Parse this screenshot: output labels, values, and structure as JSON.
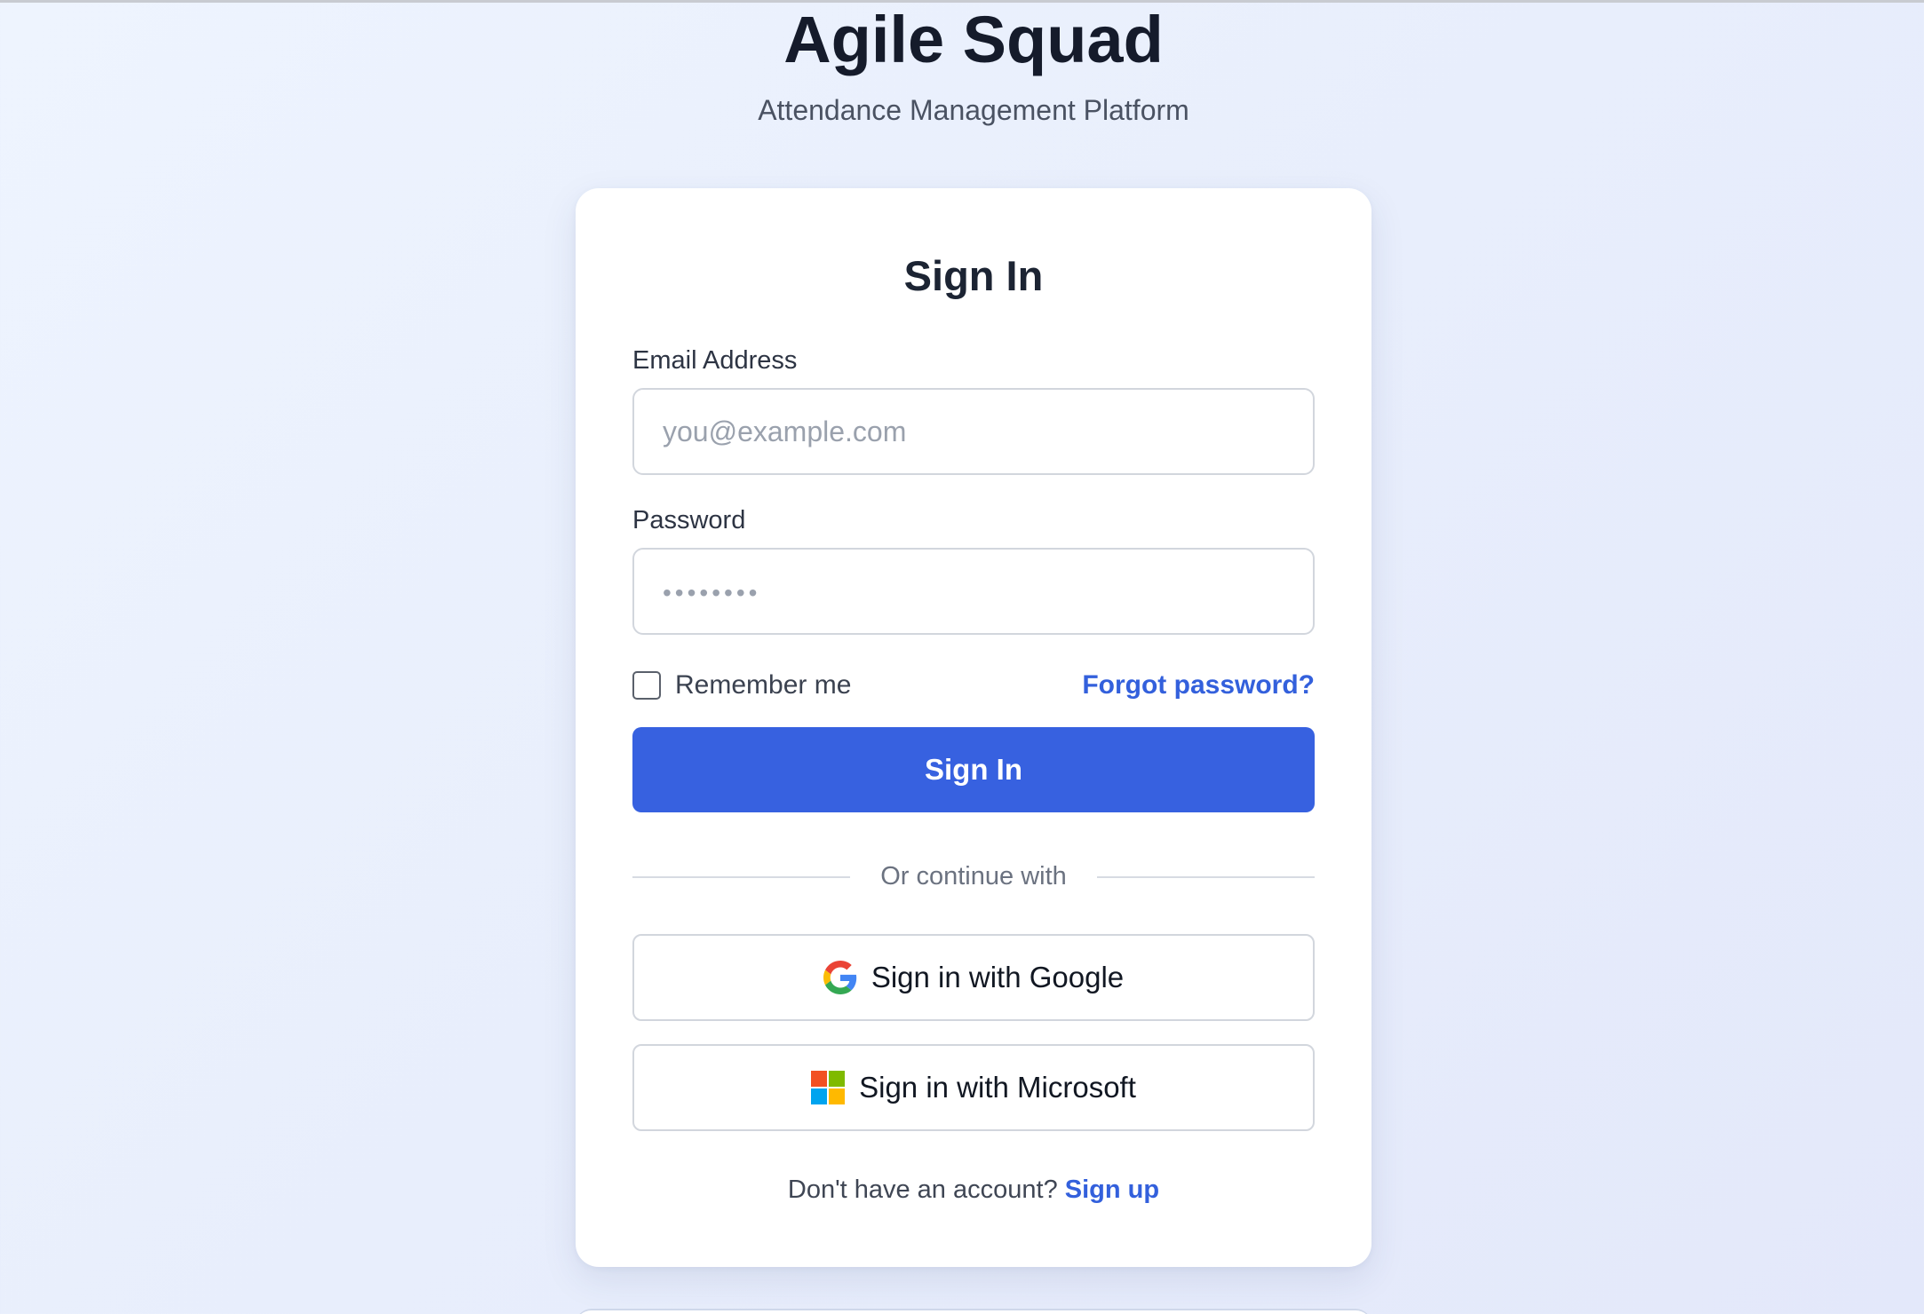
{
  "brand": {
    "title": "Agile Squad",
    "subtitle": "Attendance Management Platform"
  },
  "form": {
    "title": "Sign In",
    "email": {
      "label": "Email Address",
      "placeholder": "you@example.com",
      "value": ""
    },
    "password": {
      "label": "Password",
      "placeholder": "••••••••",
      "value": ""
    },
    "remember_label": "Remember me",
    "remember_checked": false,
    "forgot_label": "Forgot password?",
    "submit_label": "Sign In",
    "divider_label": "Or continue with",
    "google_label": "Sign in with Google",
    "microsoft_label": "Sign in with Microsoft",
    "signup_prompt": "Don't have an account?",
    "signup_label": "Sign up"
  },
  "icons": {
    "google": "google-icon",
    "microsoft": "microsoft-icon"
  },
  "colors": {
    "primary": "#3761e0",
    "link": "#3360dc",
    "google_blue": "#4285F4",
    "google_red": "#EA4335",
    "google_yellow": "#FBBC05",
    "google_green": "#34A853",
    "ms_red": "#F25022",
    "ms_green": "#7FBA00",
    "ms_blue": "#00A4EF",
    "ms_yellow": "#FFB900"
  }
}
